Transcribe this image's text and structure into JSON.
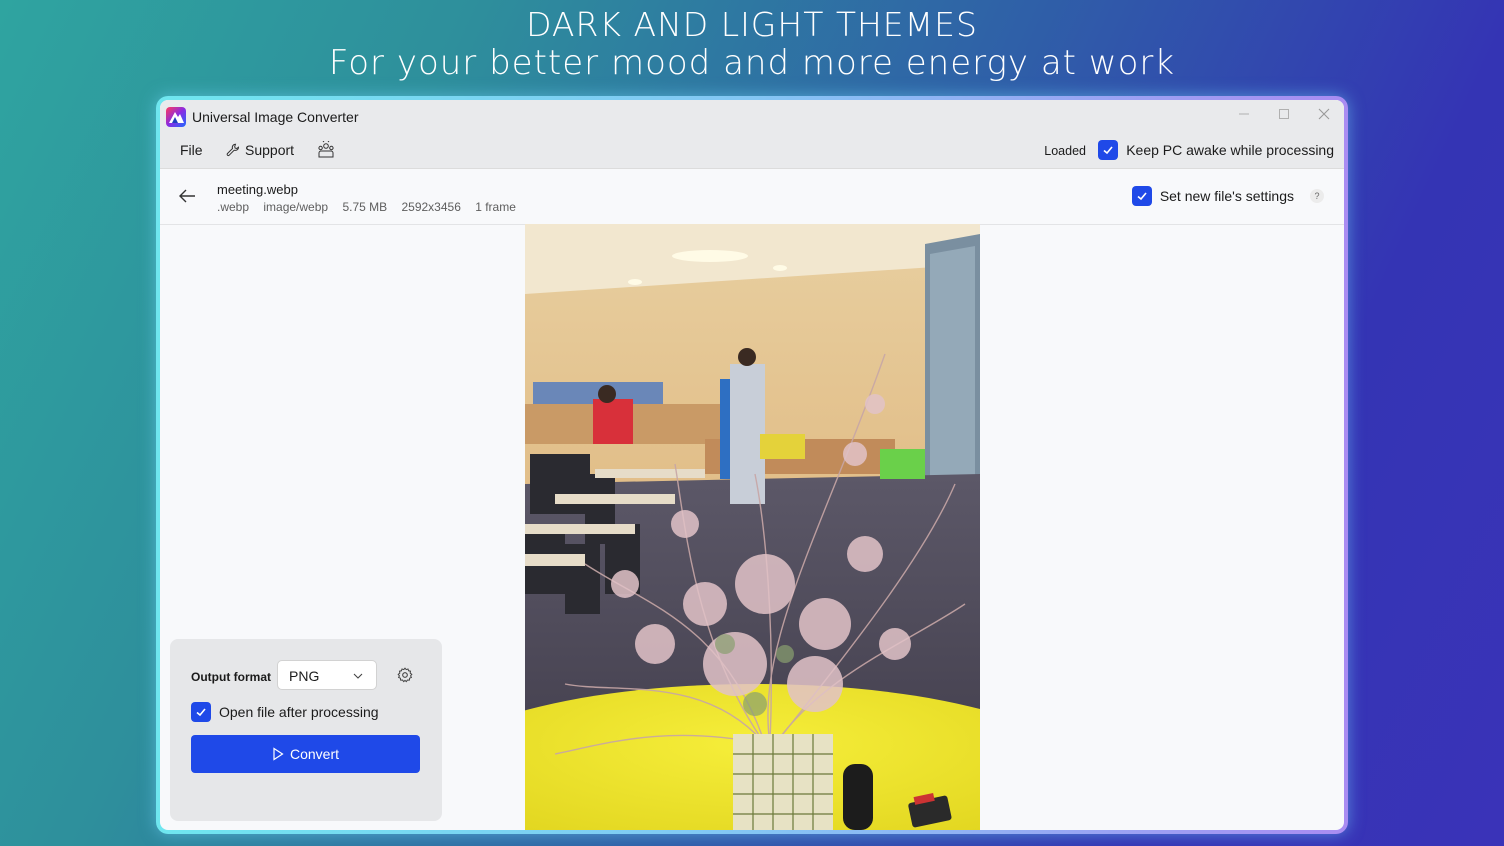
{
  "banner": {
    "line1": "DARK AND LIGHT THEMES",
    "line2": "For your better mood and more energy at work"
  },
  "window": {
    "title": "Universal Image Converter",
    "controls": {
      "minimize_icon": "minimize-icon",
      "maximize_icon": "maximize-icon",
      "close_icon": "close-icon"
    }
  },
  "menu": {
    "file": "File",
    "support": "Support",
    "status": "Loaded",
    "keep_awake": {
      "label": "Keep PC awake while processing",
      "checked": true
    }
  },
  "file_info": {
    "name": "meeting.webp",
    "extension": ".webp",
    "mime": "image/webp",
    "size": "5.75 MB",
    "dimensions": "2592x3456",
    "frames": "1 frame",
    "set_new_settings": {
      "label": "Set new file's settings",
      "checked": true
    },
    "help": "?"
  },
  "panel": {
    "output_format_label": "Output format",
    "output_format_value": "PNG",
    "open_after": {
      "label": "Open file after processing",
      "checked": true
    },
    "convert_label": "Convert"
  },
  "colors": {
    "accent": "#1f49e8",
    "window_bg": "#f8f9fb",
    "titlebar_bg": "#e9eaec",
    "panel_bg": "#e6e7e9"
  }
}
